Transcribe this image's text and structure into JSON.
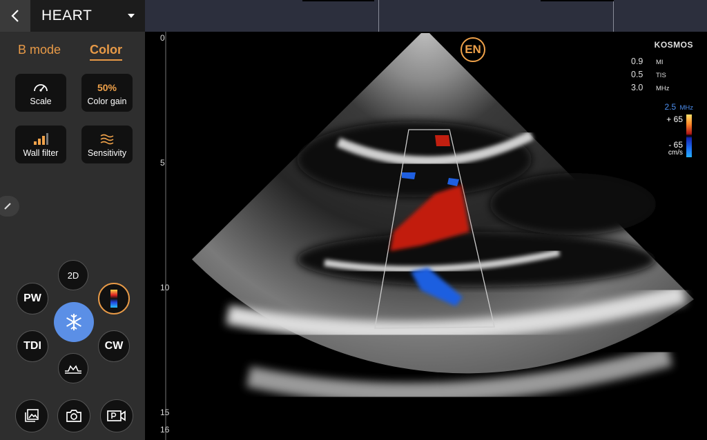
{
  "app": {
    "preset": "HEART",
    "tabs": {
      "b_mode": "B mode",
      "color": "Color"
    }
  },
  "controls": {
    "scale": {
      "label": "Scale",
      "icon": "gauge-icon"
    },
    "color_gain": {
      "label": "Color gain",
      "value": "50%"
    },
    "wall_filter": {
      "label": "Wall filter",
      "icon": "signal-bars-icon"
    },
    "sensitivity": {
      "label": "Sensitivity",
      "icon": "waves-icon"
    }
  },
  "modes": {
    "two_d": "2D",
    "pw": "PW",
    "tdi": "TDI",
    "cw": "CW",
    "freeze_icon": "snowflake-icon",
    "color_icon": "color-doppler-icon",
    "mmode_icon": "m-mode-icon"
  },
  "bottom_actions": [
    "gallery-icon",
    "camera-icon",
    "video-record-icon"
  ],
  "image": {
    "logo": "EN",
    "brand": "KOSMOS",
    "params": [
      {
        "value": "0.9",
        "unit": "MI"
      },
      {
        "value": "0.5",
        "unit": "TIS"
      },
      {
        "value": "3.0",
        "unit": "MHz"
      }
    ],
    "color_freq": {
      "value": "2.5",
      "unit": "MHz"
    },
    "velocity": {
      "positive": "+ 65",
      "negative": "- 65",
      "unit": "cm/s"
    },
    "depth_labels": [
      "0",
      "5",
      "10",
      "15",
      "16"
    ]
  },
  "colors": {
    "accent": "#e89a47",
    "panel": "#2e2e2e",
    "freeze": "#5b8fe6",
    "doppler_red": "#c21f10",
    "doppler_blue": "#1f5fe0"
  }
}
